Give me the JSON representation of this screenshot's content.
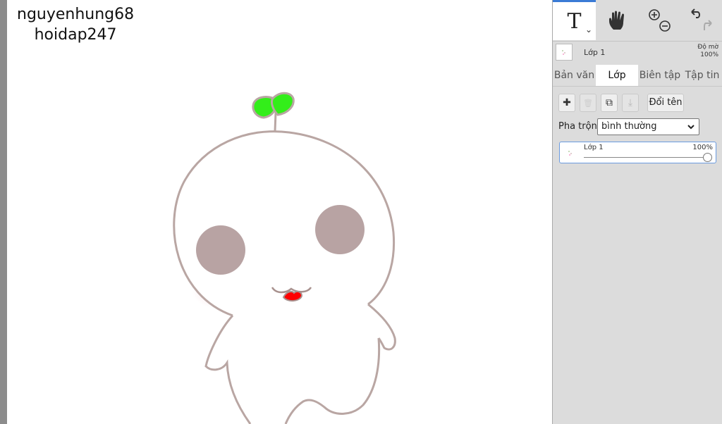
{
  "watermark": {
    "line1": "nguyenhung68",
    "line2": "hoidap247"
  },
  "toolbar": {
    "text_tool": "T",
    "text_tool_caret": "⌄",
    "hand_tool_icon": "hand-icon",
    "zoom_icons": [
      "zoom-in-icon",
      "zoom-out-icon"
    ],
    "history_icons": [
      "undo-icon",
      "redo-icon"
    ]
  },
  "layer_header": {
    "name": "Lớp 1",
    "opacity_label": "Độ mờ",
    "opacity_value": "100%"
  },
  "tabs": [
    {
      "label": "Bản văn",
      "active": false
    },
    {
      "label": "Lớp",
      "active": true
    },
    {
      "label": "Biên tập",
      "active": false
    },
    {
      "label": "Tập tin",
      "active": false
    }
  ],
  "layer_actions": {
    "add": "✚",
    "delete": "🗑",
    "duplicate": "⧉",
    "merge": "⤓",
    "rename_label": "Đổi tên"
  },
  "blend": {
    "label": "Pha trộn",
    "value": "bình thường"
  },
  "layers": [
    {
      "name": "Lớp 1",
      "opacity": "100%",
      "opacity_fraction": 1.0
    }
  ],
  "colors": {
    "canvas": "#ffffff",
    "outline": "#b9a6a3",
    "cheek": "#b8a3a3",
    "blush": "#f6d6da",
    "sprout": "#33ee1a",
    "mouth": "#ff0000",
    "accent": "#3a7bd5"
  }
}
